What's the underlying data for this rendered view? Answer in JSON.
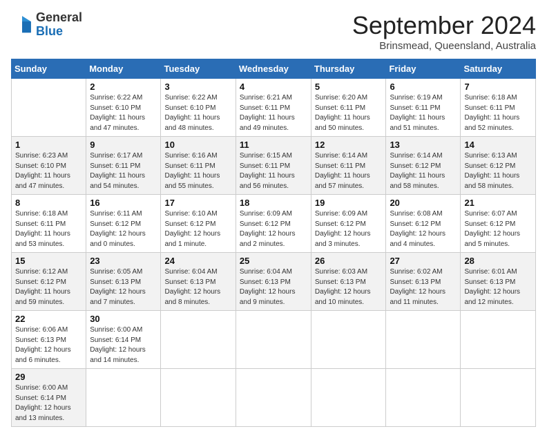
{
  "header": {
    "logo_general": "General",
    "logo_blue": "Blue",
    "month_year": "September 2024",
    "location": "Brinsmead, Queensland, Australia"
  },
  "calendar": {
    "days_of_week": [
      "Sunday",
      "Monday",
      "Tuesday",
      "Wednesday",
      "Thursday",
      "Friday",
      "Saturday"
    ],
    "weeks": [
      [
        null,
        {
          "day": "2",
          "sunrise": "6:22 AM",
          "sunset": "6:10 PM",
          "daylight": "11 hours and 47 minutes."
        },
        {
          "day": "3",
          "sunrise": "6:22 AM",
          "sunset": "6:10 PM",
          "daylight": "11 hours and 48 minutes."
        },
        {
          "day": "4",
          "sunrise": "6:21 AM",
          "sunset": "6:11 PM",
          "daylight": "11 hours and 49 minutes."
        },
        {
          "day": "5",
          "sunrise": "6:20 AM",
          "sunset": "6:11 PM",
          "daylight": "11 hours and 50 minutes."
        },
        {
          "day": "6",
          "sunrise": "6:19 AM",
          "sunset": "6:11 PM",
          "daylight": "11 hours and 51 minutes."
        },
        {
          "day": "7",
          "sunrise": "6:18 AM",
          "sunset": "6:11 PM",
          "daylight": "11 hours and 52 minutes."
        }
      ],
      [
        {
          "day": "1",
          "sunrise": "6:23 AM",
          "sunset": "6:10 PM",
          "daylight": "11 hours and 47 minutes."
        },
        {
          "day": "9",
          "sunrise": "6:17 AM",
          "sunset": "6:11 PM",
          "daylight": "11 hours and 54 minutes."
        },
        {
          "day": "10",
          "sunrise": "6:16 AM",
          "sunset": "6:11 PM",
          "daylight": "11 hours and 55 minutes."
        },
        {
          "day": "11",
          "sunrise": "6:15 AM",
          "sunset": "6:11 PM",
          "daylight": "11 hours and 56 minutes."
        },
        {
          "day": "12",
          "sunrise": "6:14 AM",
          "sunset": "6:11 PM",
          "daylight": "11 hours and 57 minutes."
        },
        {
          "day": "13",
          "sunrise": "6:14 AM",
          "sunset": "6:12 PM",
          "daylight": "11 hours and 58 minutes."
        },
        {
          "day": "14",
          "sunrise": "6:13 AM",
          "sunset": "6:12 PM",
          "daylight": "11 hours and 58 minutes."
        }
      ],
      [
        {
          "day": "8",
          "sunrise": "6:18 AM",
          "sunset": "6:11 PM",
          "daylight": "11 hours and 53 minutes."
        },
        {
          "day": "16",
          "sunrise": "6:11 AM",
          "sunset": "6:12 PM",
          "daylight": "12 hours and 0 minutes."
        },
        {
          "day": "17",
          "sunrise": "6:10 AM",
          "sunset": "6:12 PM",
          "daylight": "12 hours and 1 minute."
        },
        {
          "day": "18",
          "sunrise": "6:09 AM",
          "sunset": "6:12 PM",
          "daylight": "12 hours and 2 minutes."
        },
        {
          "day": "19",
          "sunrise": "6:09 AM",
          "sunset": "6:12 PM",
          "daylight": "12 hours and 3 minutes."
        },
        {
          "day": "20",
          "sunrise": "6:08 AM",
          "sunset": "6:12 PM",
          "daylight": "12 hours and 4 minutes."
        },
        {
          "day": "21",
          "sunrise": "6:07 AM",
          "sunset": "6:12 PM",
          "daylight": "12 hours and 5 minutes."
        }
      ],
      [
        {
          "day": "15",
          "sunrise": "6:12 AM",
          "sunset": "6:12 PM",
          "daylight": "11 hours and 59 minutes."
        },
        {
          "day": "23",
          "sunrise": "6:05 AM",
          "sunset": "6:13 PM",
          "daylight": "12 hours and 7 minutes."
        },
        {
          "day": "24",
          "sunrise": "6:04 AM",
          "sunset": "6:13 PM",
          "daylight": "12 hours and 8 minutes."
        },
        {
          "day": "25",
          "sunrise": "6:04 AM",
          "sunset": "6:13 PM",
          "daylight": "12 hours and 9 minutes."
        },
        {
          "day": "26",
          "sunrise": "6:03 AM",
          "sunset": "6:13 PM",
          "daylight": "12 hours and 10 minutes."
        },
        {
          "day": "27",
          "sunrise": "6:02 AM",
          "sunset": "6:13 PM",
          "daylight": "12 hours and 11 minutes."
        },
        {
          "day": "28",
          "sunrise": "6:01 AM",
          "sunset": "6:13 PM",
          "daylight": "12 hours and 12 minutes."
        }
      ],
      [
        {
          "day": "22",
          "sunrise": "6:06 AM",
          "sunset": "6:13 PM",
          "daylight": "12 hours and 6 minutes."
        },
        {
          "day": "30",
          "sunrise": "6:00 AM",
          "sunset": "6:14 PM",
          "daylight": "12 hours and 14 minutes."
        },
        null,
        null,
        null,
        null,
        null
      ],
      [
        {
          "day": "29",
          "sunrise": "6:00 AM",
          "sunset": "6:14 PM",
          "daylight": "12 hours and 13 minutes."
        },
        null,
        null,
        null,
        null,
        null,
        null
      ]
    ]
  }
}
